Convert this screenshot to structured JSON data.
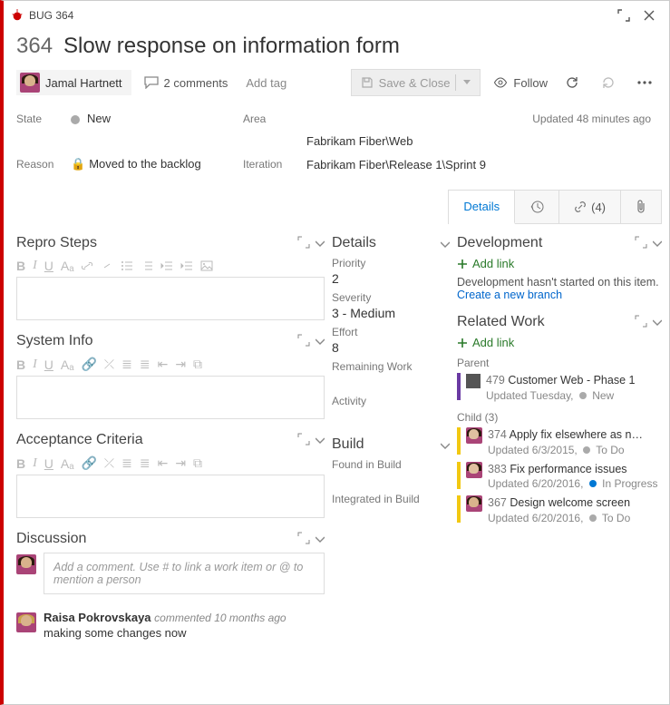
{
  "window": {
    "tag": "BUG 364"
  },
  "bug": {
    "id": "364",
    "title": "Slow response on information form"
  },
  "assignee": {
    "name": "Jamal Hartnett"
  },
  "comments": {
    "label": "2 comments"
  },
  "actions": {
    "add_tag": "Add tag",
    "save_close": "Save & Close",
    "follow": "Follow"
  },
  "meta": {
    "state_label": "State",
    "state_value": "New",
    "reason_label": "Reason",
    "reason_value": "Moved to the backlog",
    "area_label": "Area",
    "area_value": "Fabrikam Fiber\\Web",
    "iteration_label": "Iteration",
    "iteration_value": "Fabrikam Fiber\\Release 1\\Sprint 9",
    "updated": "Updated 48 minutes ago"
  },
  "sidetabs": {
    "details": "Details",
    "links_count": "(4)"
  },
  "left": {
    "repro": "Repro Steps",
    "sysinfo": "System Info",
    "acceptance": "Acceptance Criteria",
    "discussion": "Discussion",
    "discussion_placeholder": "Add a comment. Use # to link a work item or @ to mention a person"
  },
  "mid": {
    "details": "Details",
    "priority_label": "Priority",
    "priority_value": "2",
    "severity_label": "Severity",
    "severity_value": "3 - Medium",
    "effort_label": "Effort",
    "effort_value": "8",
    "remaining_label": "Remaining Work",
    "activity_label": "Activity",
    "build": "Build",
    "found_label": "Found in Build",
    "integrated_label": "Integrated in Build"
  },
  "right": {
    "development": "Development",
    "add_link": "Add link",
    "dev_none": "Development hasn't started on this item.",
    "create_branch": "Create a new branch",
    "related": "Related Work",
    "parent_label": "Parent",
    "parent": {
      "id": "479",
      "title": "Customer Web - Phase 1",
      "sub": "Updated Tuesday,",
      "state": "New"
    },
    "child_label": "Child (3)",
    "children": [
      {
        "id": "374",
        "title": "Apply fix elsewhere as n…",
        "sub": "Updated 6/3/2015,",
        "state": "To Do"
      },
      {
        "id": "383",
        "title": "Fix performance issues",
        "sub": "Updated 6/20/2016,",
        "state": "In Progress"
      },
      {
        "id": "367",
        "title": "Design welcome screen",
        "sub": "Updated 6/20/2016,",
        "state": "To Do"
      }
    ]
  },
  "discussion_thread": {
    "author": "Raisa Pokrovskaya",
    "when_prefix": "commented",
    "when": "10 months ago",
    "text": "making some changes now"
  }
}
